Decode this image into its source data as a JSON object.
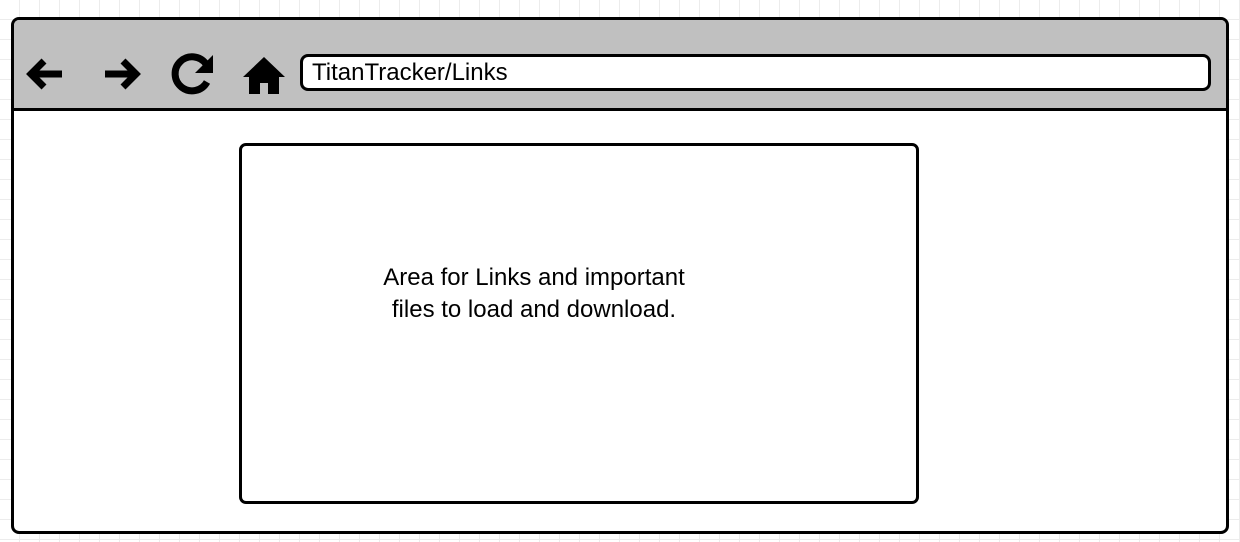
{
  "toolbar": {
    "buttons": [
      {
        "icon": "arrow-left-icon",
        "label": "back"
      },
      {
        "icon": "arrow-right-icon",
        "label": "forward"
      },
      {
        "icon": "reload-icon",
        "label": "reload"
      },
      {
        "icon": "home-icon",
        "label": "home"
      }
    ]
  },
  "address_bar": {
    "url": "TitanTracker/Links"
  },
  "content": {
    "line1": "Area for Links and important",
    "line2": "files to load and download."
  },
  "colors": {
    "toolbar_bg": "#c0c0c0",
    "border": "#000000",
    "page_bg": "#ffffff",
    "grid": "#ececec"
  }
}
